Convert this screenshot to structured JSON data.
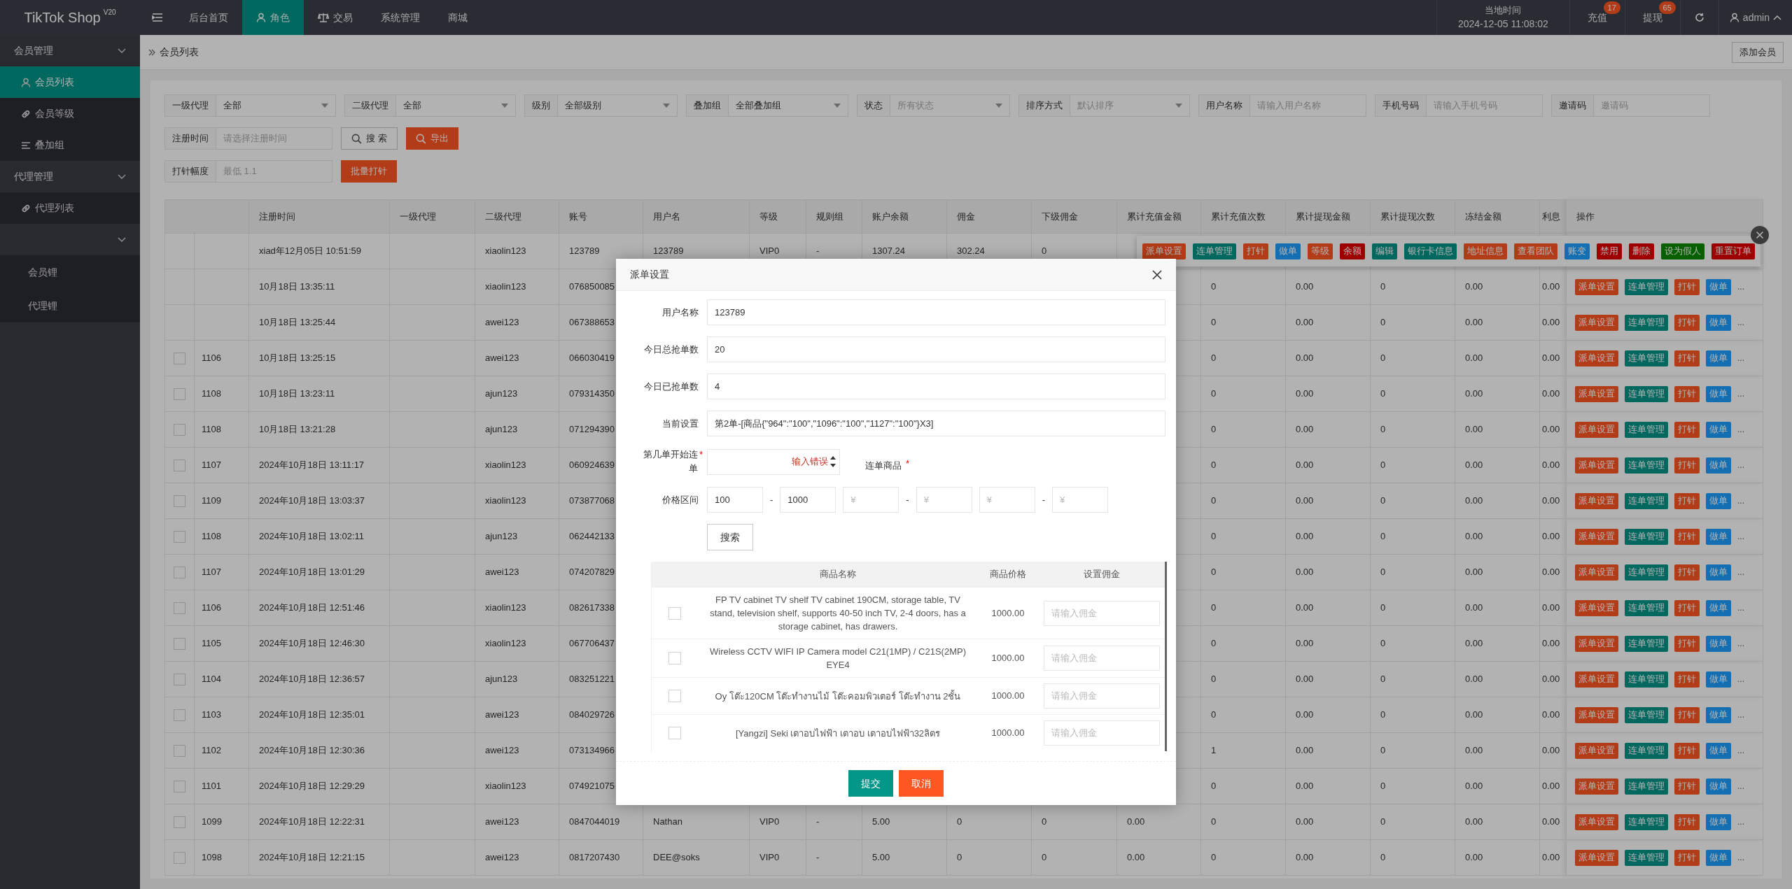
{
  "header": {
    "logo": "TikTok Shop",
    "version": "V20",
    "nav": [
      {
        "label": "后台首页",
        "selected": false
      },
      {
        "label": "角色",
        "selected": true
      },
      {
        "label": "交易",
        "selected": false
      },
      {
        "label": "系统管理",
        "selected": false
      },
      {
        "label": "商城",
        "selected": false
      }
    ],
    "clock_label": "当地时间",
    "clock": "2024-12-05 11:08:02",
    "counters": [
      {
        "label": "充值",
        "badge": "17"
      },
      {
        "label": "提现",
        "badge": "65"
      }
    ],
    "user": "admin"
  },
  "sidebar": [
    {
      "kind": "group",
      "label": "会员管理",
      "expanded": true
    },
    {
      "kind": "item",
      "label": "会员列表",
      "selected": true
    },
    {
      "kind": "item",
      "label": "会员等级",
      "selected": false
    },
    {
      "kind": "item",
      "label": "叠加组",
      "selected": false
    },
    {
      "kind": "group",
      "label": "代理管理",
      "expanded": true
    },
    {
      "kind": "item",
      "label": "代理列表",
      "selected": false
    },
    {
      "kind": "group",
      "expanded": true
    },
    {
      "kind": "subitem",
      "label": "会员锂",
      "selected": false
    },
    {
      "kind": "subitem",
      "label": "代理锂",
      "selected": false
    }
  ],
  "breadcrumb": "会员列表",
  "add_button": "添加会员",
  "filter_rows": [
    [
      {
        "kind": "select",
        "label": "一级代理",
        "value": "全部"
      },
      {
        "kind": "select",
        "label": "二级代理",
        "value": "全部"
      },
      {
        "kind": "select",
        "label": "级别",
        "value": "全部级别"
      },
      {
        "kind": "select",
        "label": "叠加组",
        "value": "全部叠加组"
      },
      {
        "kind": "select",
        "label": "状态",
        "placeholder": "所有状态"
      },
      {
        "kind": "select",
        "label": "排序方式",
        "placeholder": "默认排序"
      },
      {
        "kind": "input",
        "label": "用户名称",
        "placeholder": "请输入用户名称"
      },
      {
        "kind": "input",
        "label": "手机号码",
        "placeholder": "请输入手机号码"
      },
      {
        "kind": "input",
        "label": "邀请码",
        "placeholder": "邀请码"
      }
    ],
    [
      {
        "kind": "input",
        "label": "注册时间",
        "placeholder": "请选择注册时间"
      },
      {
        "kind": "outline-button",
        "label": "搜 索"
      },
      {
        "kind": "filled-button",
        "label": "导出"
      }
    ],
    [
      {
        "kind": "input",
        "label": "打针幅度",
        "placeholder": "最低 1.1"
      },
      {
        "kind": "filled-button",
        "label": "批量打针"
      }
    ]
  ],
  "table": {
    "columns": [
      "注册时间",
      "一级代理",
      "二级代理",
      "账号",
      "用户名",
      "等级",
      "规则组",
      "账户余额",
      "佣金",
      "下级佣金",
      "累计充值金额",
      "累计充值次数",
      "累计提现金额",
      "累计提现次数",
      "冻结金额",
      "利息",
      "操作"
    ],
    "rows": [
      {
        "cells": [
          "xiad年12月05日 10:51:59",
          null,
          "xiaolin123",
          "123789",
          "123789",
          "VIP0",
          "-",
          "1307.24",
          "302.24",
          "0",
          null,
          null,
          null,
          null,
          null,
          null
        ],
        "popover": [
          {
            "label": "派单设置",
            "kind": "warn"
          },
          {
            "label": "连单管理",
            "kind": "primary"
          },
          {
            "label": "打针",
            "kind": "warn"
          },
          {
            "label": "做单",
            "kind": "info"
          },
          {
            "label": "等级",
            "kind": "warn"
          },
          {
            "label": "余额",
            "kind": "danger"
          },
          {
            "label": "编辑",
            "kind": "primary"
          },
          {
            "label": "银行卡信息",
            "kind": "primary"
          },
          {
            "label": "地址信息",
            "kind": "warn"
          },
          {
            "label": "查看团队",
            "kind": "warn"
          },
          {
            "label": "账变",
            "kind": "info"
          },
          {
            "label": "禁用",
            "kind": "danger"
          },
          {
            "label": "删除",
            "kind": "danger"
          },
          {
            "label": "设为假人",
            "kind": "success"
          },
          {
            "label": "重置订单",
            "kind": "danger"
          }
        ]
      },
      {
        "cells": [
          "10月18日 13:35:11",
          null,
          "xiaolin123",
          "076850085",
          null,
          null,
          null,
          null,
          null,
          null,
          null,
          "0",
          "0.00",
          "0",
          "0.00",
          "0.00"
        ],
        "actions": [
          {
            "label": "派单设置",
            "kind": "warn"
          },
          {
            "label": "连单管理",
            "kind": "primary"
          },
          {
            "label": "打针",
            "kind": "warn"
          },
          {
            "label": "做单",
            "kind": "info"
          }
        ],
        "more": "..."
      },
      {
        "cells": [
          "10月18日 13:25:44",
          null,
          "awei123",
          "067388653",
          null,
          null,
          null,
          null,
          null,
          null,
          null,
          "0",
          "0.00",
          "0",
          "0.00",
          "0.00"
        ],
        "actions": [
          {
            "label": "派单设置",
            "kind": "warn"
          },
          {
            "label": "连单管理",
            "kind": "primary"
          },
          {
            "label": "打针",
            "kind": "warn"
          },
          {
            "label": "做单",
            "kind": "info"
          }
        ],
        "more": "..."
      },
      {
        "checked": false,
        "id": "1106",
        "cells": [
          "10月18日 13:25:15",
          null,
          "awei123",
          "066030419",
          null,
          null,
          null,
          null,
          null,
          null,
          null,
          "0",
          "0.00",
          "0",
          "0.00",
          "0.00"
        ],
        "actions": [
          {
            "label": "派单设置",
            "kind": "warn"
          },
          {
            "label": "连单管理",
            "kind": "primary"
          },
          {
            "label": "打针",
            "kind": "warn"
          },
          {
            "label": "做单",
            "kind": "info"
          }
        ],
        "more": "..."
      },
      {
        "checked": false,
        "id": "1108",
        "cells": [
          "10月18日 13:23:11",
          null,
          "ajun123",
          "079314350",
          null,
          null,
          null,
          null,
          null,
          null,
          null,
          "0",
          "0.00",
          "0",
          "0.00",
          "0.00"
        ],
        "actions": [
          {
            "label": "派单设置",
            "kind": "warn"
          },
          {
            "label": "连单管理",
            "kind": "primary"
          },
          {
            "label": "打针",
            "kind": "warn"
          },
          {
            "label": "做单",
            "kind": "info"
          }
        ],
        "more": "..."
      },
      {
        "checked": false,
        "id": "1108",
        "cells": [
          "10月18日 13:21:28",
          null,
          "ajun123",
          "071294390",
          null,
          null,
          null,
          null,
          null,
          null,
          null,
          "0",
          "0.00",
          "0",
          "0.00",
          "0.00"
        ],
        "actions": [
          {
            "label": "派单设置",
            "kind": "warn"
          },
          {
            "label": "连单管理",
            "kind": "primary"
          },
          {
            "label": "打针",
            "kind": "warn"
          },
          {
            "label": "做单",
            "kind": "info"
          }
        ],
        "more": "..."
      },
      {
        "checked": false,
        "id": "1107",
        "cells": [
          "2024年10月18日 13:11:17",
          null,
          "xiaolin123",
          "060924639",
          null,
          null,
          null,
          null,
          null,
          null,
          null,
          "0",
          "0.00",
          "0",
          "0.00",
          "0.00"
        ],
        "actions": [
          {
            "label": "派单设置",
            "kind": "warn"
          },
          {
            "label": "连单管理",
            "kind": "primary"
          },
          {
            "label": "打针",
            "kind": "warn"
          },
          {
            "label": "做单",
            "kind": "info"
          }
        ],
        "more": "..."
      },
      {
        "checked": false,
        "id": "1109",
        "cells": [
          "2024年10月18日 13:03:37",
          null,
          "xiaolin123",
          "073877068",
          null,
          null,
          null,
          null,
          null,
          null,
          null,
          "0",
          "0.00",
          "0",
          "0.00",
          "0.00"
        ],
        "actions": [
          {
            "label": "派单设置",
            "kind": "warn"
          },
          {
            "label": "连单管理",
            "kind": "primary"
          },
          {
            "label": "打针",
            "kind": "warn"
          },
          {
            "label": "做单",
            "kind": "info"
          }
        ],
        "more": "..."
      },
      {
        "checked": false,
        "id": "1108",
        "cells": [
          "2024年10月18日 13:02:11",
          null,
          "ajun123",
          "062442133",
          null,
          null,
          null,
          null,
          null,
          null,
          null,
          "0",
          "0.00",
          "0",
          "0.00",
          "0.00"
        ],
        "actions": [
          {
            "label": "派单设置",
            "kind": "warn"
          },
          {
            "label": "连单管理",
            "kind": "primary"
          },
          {
            "label": "打针",
            "kind": "warn"
          },
          {
            "label": "做单",
            "kind": "info"
          }
        ],
        "more": "..."
      },
      {
        "checked": false,
        "id": "1107",
        "cells": [
          "2024年10月18日 13:01:29",
          null,
          "awei123",
          "074207829",
          null,
          null,
          null,
          null,
          null,
          null,
          null,
          "0",
          "0.00",
          "0",
          "0.00",
          "0.00"
        ],
        "actions": [
          {
            "label": "派单设置",
            "kind": "warn"
          },
          {
            "label": "连单管理",
            "kind": "primary"
          },
          {
            "label": "打针",
            "kind": "warn"
          },
          {
            "label": "做单",
            "kind": "info"
          }
        ],
        "more": "..."
      },
      {
        "checked": false,
        "id": "1106",
        "cells": [
          "2024年10月18日 12:51:46",
          null,
          "xiaolin123",
          "082617338",
          null,
          null,
          null,
          null,
          null,
          null,
          null,
          "0",
          "0.00",
          "0",
          "0.00",
          "0.00"
        ],
        "actions": [
          {
            "label": "派单设置",
            "kind": "warn"
          },
          {
            "label": "连单管理",
            "kind": "primary"
          },
          {
            "label": "打针",
            "kind": "warn"
          },
          {
            "label": "做单",
            "kind": "info"
          }
        ],
        "more": "..."
      },
      {
        "checked": false,
        "id": "1105",
        "cells": [
          "2024年10月18日 12:46:30",
          null,
          "xiaolin123",
          "067706437",
          null,
          null,
          null,
          null,
          null,
          null,
          null,
          "0",
          "0.00",
          "0",
          "0.00",
          "0.00"
        ],
        "actions": [
          {
            "label": "派单设置",
            "kind": "warn"
          },
          {
            "label": "连单管理",
            "kind": "primary"
          },
          {
            "label": "打针",
            "kind": "warn"
          },
          {
            "label": "做单",
            "kind": "info"
          }
        ],
        "more": "..."
      },
      {
        "checked": false,
        "id": "1104",
        "cells": [
          "2024年10月18日 12:36:57",
          null,
          "ajun123",
          "083251221",
          null,
          null,
          null,
          null,
          null,
          null,
          null,
          "0",
          "0.00",
          "0",
          "0.00",
          "0.00"
        ],
        "actions": [
          {
            "label": "派单设置",
            "kind": "warn"
          },
          {
            "label": "连单管理",
            "kind": "primary"
          },
          {
            "label": "打针",
            "kind": "warn"
          },
          {
            "label": "做单",
            "kind": "info"
          }
        ],
        "more": "..."
      },
      {
        "checked": false,
        "id": "1103",
        "cells": [
          "2024年10月18日 12:35:01",
          null,
          "awei123",
          "084029726",
          null,
          null,
          null,
          null,
          null,
          null,
          null,
          "0",
          "0.00",
          "0",
          "0.00",
          "0.00"
        ],
        "actions": [
          {
            "label": "派单设置",
            "kind": "warn"
          },
          {
            "label": "连单管理",
            "kind": "primary"
          },
          {
            "label": "打针",
            "kind": "warn"
          },
          {
            "label": "做单",
            "kind": "info"
          }
        ],
        "more": "..."
      },
      {
        "checked": false,
        "id": "1102",
        "cells": [
          "2024年10月18日 12:30:36",
          null,
          "awei123",
          "073134966",
          null,
          null,
          null,
          null,
          null,
          null,
          null,
          "1",
          "0.00",
          "0",
          "0.00",
          "0.00"
        ],
        "actions": [
          {
            "label": "派单设置",
            "kind": "warn"
          },
          {
            "label": "连单管理",
            "kind": "primary"
          },
          {
            "label": "打针",
            "kind": "warn"
          },
          {
            "label": "做单",
            "kind": "info"
          }
        ],
        "more": "..."
      },
      {
        "checked": false,
        "id": "1101",
        "cells": [
          "2024年10月18日 12:29:29",
          null,
          "xiaolin123",
          "074921075",
          null,
          null,
          null,
          null,
          null,
          null,
          null,
          "0",
          "0.00",
          "0",
          "0.00",
          "0.00"
        ],
        "actions": [
          {
            "label": "派单设置",
            "kind": "warn"
          },
          {
            "label": "连单管理",
            "kind": "primary"
          },
          {
            "label": "打针",
            "kind": "warn"
          },
          {
            "label": "做单",
            "kind": "info"
          }
        ],
        "more": "..."
      },
      {
        "checked": false,
        "id": "1099",
        "cells": [
          "2024年10月18日 12:22:31",
          null,
          "awei123",
          "0847044019",
          "Nathan",
          "VIP0",
          "-",
          "5.00",
          "0",
          "0",
          "0.00",
          "0",
          "0.00",
          "0",
          "0.00",
          "0.00"
        ],
        "actions": [
          {
            "label": "派单设置",
            "kind": "warn"
          },
          {
            "label": "连单管理",
            "kind": "primary"
          },
          {
            "label": "打针",
            "kind": "warn"
          },
          {
            "label": "做单",
            "kind": "info"
          }
        ],
        "more": "..."
      },
      {
        "checked": false,
        "id": "1098",
        "cells": [
          "2024年10月18日 12:21:15",
          null,
          "awei123",
          "0817207430",
          "DEE@soks",
          "VIP0",
          "-",
          "5.00",
          "0",
          "0",
          "0.00",
          "0",
          "0.00",
          "0",
          "0.00",
          "0.00"
        ],
        "actions": [
          {
            "label": "派单设置",
            "kind": "warn"
          },
          {
            "label": "连单管理",
            "kind": "primary"
          },
          {
            "label": "打针",
            "kind": "warn"
          },
          {
            "label": "做单",
            "kind": "info"
          }
        ],
        "more": "..."
      }
    ]
  },
  "modal": {
    "title": "派单设置",
    "fields": [
      {
        "label": "用户名称",
        "value": "123789"
      },
      {
        "label": "今日总抢单数",
        "value": "20"
      },
      {
        "label": "今日已抢单数",
        "value": "4"
      },
      {
        "label": "当前设置",
        "value": "第2单-[商品{\"964\":\"100\",\"1096\":\"100\",\"1127\":\"100\"}X3]"
      }
    ],
    "start_order": {
      "label": "第几单开始连单",
      "required_mark": "*",
      "error": "输入错误"
    },
    "combo_goods": {
      "label": "连单商品",
      "required_mark": "*"
    },
    "price_range": {
      "label": "价格区间",
      "items": [
        {
          "kind": "field",
          "value": "100"
        },
        {
          "kind": "dash",
          "text": "-"
        },
        {
          "kind": "field",
          "value": "1000"
        },
        {
          "kind": "field",
          "placeholder": "¥"
        },
        {
          "kind": "dash",
          "text": "-"
        },
        {
          "kind": "field",
          "placeholder": "¥"
        },
        {
          "kind": "field",
          "placeholder": "¥"
        },
        {
          "kind": "dash",
          "text": "-"
        },
        {
          "kind": "field",
          "placeholder": "¥"
        }
      ]
    },
    "search_button": "搜索",
    "goods_table": {
      "columns": [
        "商品名称",
        "商品价格",
        "设置佣金"
      ],
      "rows": [
        {
          "checked": false,
          "name": "FP TV cabinet TV shelf TV cabinet 190CM, storage table, TV stand, television shelf, supports 40-50 inch TV, 2-4 doors, has a storage cabinet, has drawers.",
          "price": "1000.00",
          "placeholder": "请输入佣金"
        },
        {
          "checked": false,
          "name": "Wireless CCTV WIFI IP Camera model C21(1MP) / C21S(2MP) EYE4",
          "price": "1000.00",
          "placeholder": "请输入佣金"
        },
        {
          "checked": false,
          "name": "Oy โต๊ะ120CM โต๊ะทำงานไม้ โต๊ะคอมพิวเตอร์ โต๊ะทำงาน 2ชั้น",
          "price": "1000.00",
          "placeholder": "请输入佣金"
        },
        {
          "checked": false,
          "name": "[Yangzi] Seki เตาอบไฟฟ้า เตาอบ เตาอบไฟฟ้า32ลิตร",
          "price": "1000.00",
          "placeholder": "请输入佣金"
        }
      ]
    },
    "buttons": [
      {
        "label": "提交",
        "kind": "primary"
      },
      {
        "label": "取消",
        "kind": "warn"
      }
    ]
  }
}
